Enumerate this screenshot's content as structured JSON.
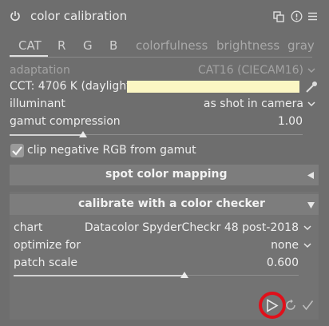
{
  "module": {
    "title": "color calibration"
  },
  "tabs": [
    {
      "label": "CAT",
      "active": true
    },
    {
      "label": "R"
    },
    {
      "label": "G"
    },
    {
      "label": "B"
    },
    {
      "label": "colorfulness"
    },
    {
      "label": "brightness"
    },
    {
      "label": "gray"
    }
  ],
  "adaptation": {
    "label": "adaptation",
    "value": "CAT16 (CIECAM16)"
  },
  "cct": {
    "label": "CCT: 4706 K (daylight)",
    "swatch_color": "#fbf6c3"
  },
  "illuminant": {
    "label": "illuminant",
    "value": "as shot in camera"
  },
  "gamut_compression": {
    "label": "gamut compression",
    "value": "1.00",
    "level": 0.25
  },
  "clip_negative": {
    "label": "clip negative RGB from gamut",
    "checked": true
  },
  "spot_color_mapping": {
    "title": "spot color mapping",
    "expanded": false
  },
  "checker": {
    "title": "calibrate with a color checker",
    "expanded": true,
    "chart": {
      "label": "chart",
      "value": "Datacolor SpyderCheckr 48 post-2018"
    },
    "optimize_for": {
      "label": "optimize for",
      "value": "none"
    },
    "patch_scale": {
      "label": "patch scale",
      "value": "0.600",
      "level": 0.6
    }
  },
  "icons": {
    "power": "power-icon",
    "multi_instance": "multi-instance-icon",
    "presets": "presets-icon",
    "reset": "reset-icon",
    "picker": "color-picker-icon",
    "run": "play-icon",
    "recompute": "refresh-icon",
    "validate": "checkmark-icon"
  },
  "colors": {
    "background": "#6e6e6e",
    "highlight": "#e0101a"
  }
}
